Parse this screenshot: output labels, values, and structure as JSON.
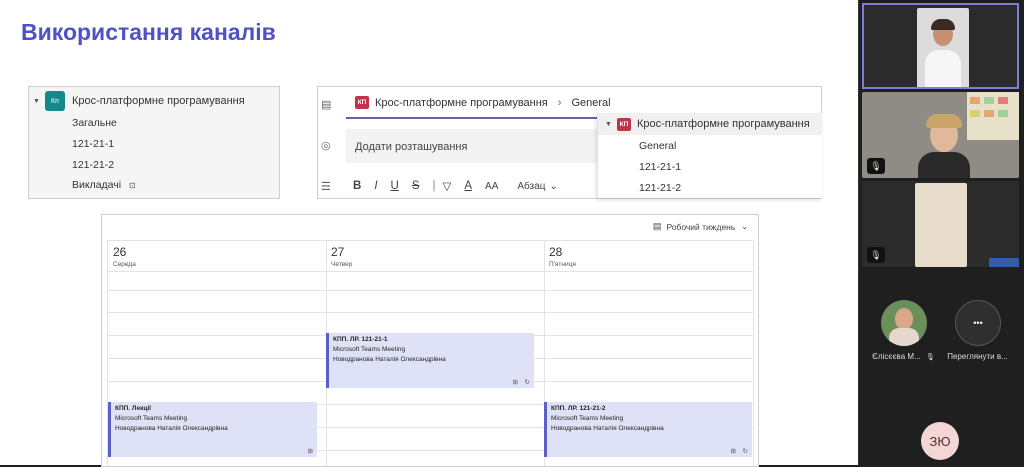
{
  "slide": {
    "title": "Використання каналів"
  },
  "channel_list": {
    "team_avatar": "Кп",
    "team_name": "Крос-платформне програмування",
    "channels": [
      "Загальне",
      "121-21-1",
      "121-21-2",
      "Викладачі"
    ],
    "private_icon": "lock-icon"
  },
  "meeting_form": {
    "channel_badge": "КП",
    "channel_name": "Крос-платформне програмування",
    "channel_separator": "›",
    "channel_selected": "General",
    "location_placeholder": "Додати розташування",
    "toolbar": {
      "bold": "B",
      "italic": "I",
      "underline": "U",
      "strike": "S",
      "marker": "▽",
      "font_color": "A",
      "font_size": "AA",
      "paragraph": "Абзац",
      "paragraph_chevron": "⌄"
    },
    "dropdown": {
      "badge": "КП",
      "team_name": "Крос-платформне програмування",
      "items": [
        "General",
        "121-21-1",
        "121-21-2"
      ]
    }
  },
  "calendar": {
    "view_label": "Робочий тиждень",
    "days": [
      {
        "num": "26",
        "name": "Середа"
      },
      {
        "num": "27",
        "name": "Четвер"
      },
      {
        "num": "28",
        "name": "П'ятниця"
      }
    ],
    "events": [
      {
        "title": "КПП. ЛР. 121-21-1",
        "subtitle": "Microsoft Teams Meeting",
        "organizer": "Новодранова Наталія Олександрівна"
      },
      {
        "title": "КПП. Лекції",
        "subtitle": "Microsoft Teams Meeting",
        "organizer": "Новодранова Наталія Олександрівна"
      },
      {
        "title": "КПП. ЛР. 121-21-2",
        "subtitle": "Microsoft Teams Meeting",
        "organizer": "Новодранова Наталія Олександрівна"
      }
    ]
  },
  "participants": {
    "small": [
      {
        "name": "Єлісєєва М..."
      },
      {
        "name": "Переглянути в..."
      }
    ],
    "initials": "ЗЮ",
    "more_glyph": "•••",
    "mute_glyph": "🎙"
  },
  "colors": {
    "title": "#4f52c6",
    "teams_purple": "#5b5fc7",
    "event_bg": "#dfe1f7",
    "badge_red": "#c4314b",
    "team_teal": "#108a8a"
  }
}
